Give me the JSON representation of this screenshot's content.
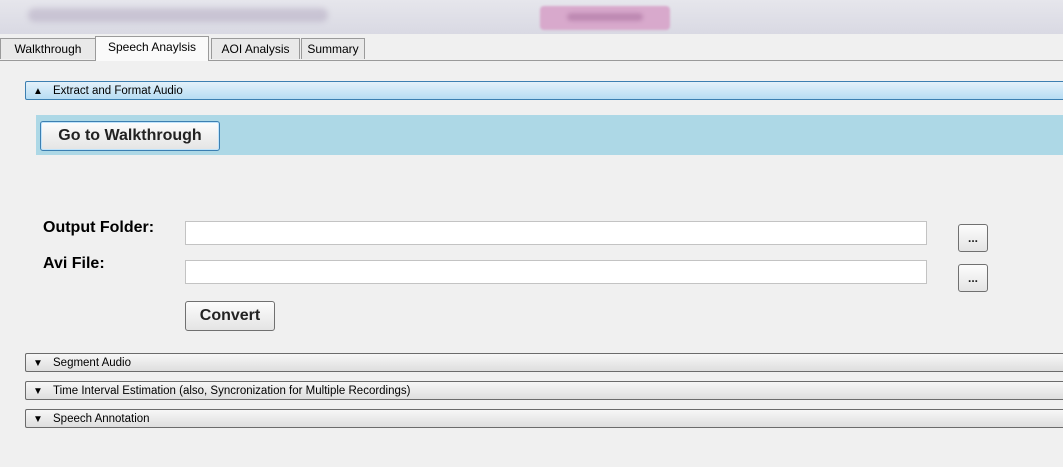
{
  "tabs": [
    {
      "label": "Walkthrough",
      "active": false
    },
    {
      "label": "Speech Anaylsis",
      "active": true
    },
    {
      "label": "AOI Analysis",
      "active": false
    },
    {
      "label": "Summary",
      "active": false
    }
  ],
  "expanders": [
    {
      "label": "Extract and Format Audio",
      "expanded": true,
      "arrow": "▲"
    },
    {
      "label": "Segment Audio",
      "expanded": false,
      "arrow": "▼"
    },
    {
      "label": "Time Interval Estimation (also, Syncronization for Multiple Recordings)",
      "expanded": false,
      "arrow": "▼"
    },
    {
      "label": "Speech Annotation",
      "expanded": false,
      "arrow": "▼"
    }
  ],
  "extract_panel": {
    "go_button": "Go to Walkthrough",
    "output_folder_label": "Output Folder:",
    "output_folder_value": "",
    "avi_file_label": "Avi File:",
    "avi_file_value": "",
    "browse_label": "...",
    "convert_button": "Convert"
  },
  "colors": {
    "accent_band": "#add8e6",
    "expanded_header": "#b6dcf3",
    "title_pill": "#d8a9cc"
  }
}
